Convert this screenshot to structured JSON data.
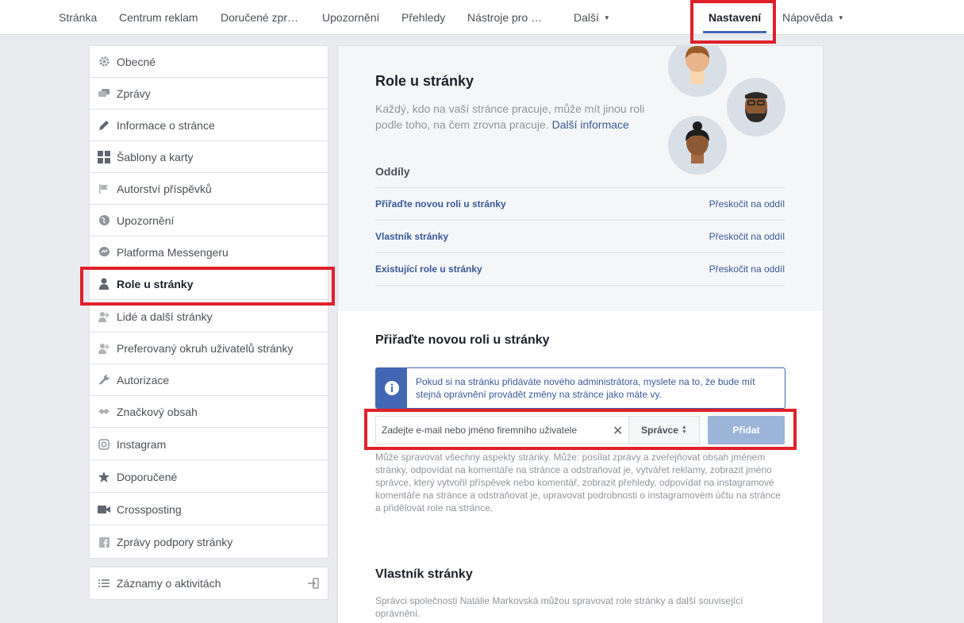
{
  "topnav": {
    "items": [
      "Stránka",
      "Centrum reklam",
      "Doručené zpr…",
      "Upozornění",
      "Přehledy",
      "Nástroje pro …",
      "Další",
      "Nastavení",
      "Nápověda"
    ],
    "active": "Nastavení"
  },
  "sidebar": {
    "items": [
      {
        "label": "Obecné",
        "icon": "gear-icon"
      },
      {
        "label": "Zprávy",
        "icon": "chat-icon"
      },
      {
        "label": "Informace o stránce",
        "icon": "pencil-icon"
      },
      {
        "label": "Šablony a karty",
        "icon": "grid-icon"
      },
      {
        "label": "Autorství příspěvků",
        "icon": "flag-icon"
      },
      {
        "label": "Upozornění",
        "icon": "globe-icon"
      },
      {
        "label": "Platforma Messengeru",
        "icon": "messenger-icon"
      },
      {
        "label": "Role u stránky",
        "icon": "person-icon"
      },
      {
        "label": "Lidé a další stránky",
        "icon": "people-icon"
      },
      {
        "label": "Preferovaný okruh uživatelů stránky",
        "icon": "people-icon"
      },
      {
        "label": "Autorizace",
        "icon": "wrench-icon"
      },
      {
        "label": "Značkový obsah",
        "icon": "handshake-icon"
      },
      {
        "label": "Instagram",
        "icon": "instagram-icon"
      },
      {
        "label": "Doporučené",
        "icon": "star-icon"
      },
      {
        "label": "Crossposting",
        "icon": "video-icon"
      },
      {
        "label": "Zprávy podpory stránky",
        "icon": "facebook-icon"
      }
    ],
    "active": "Role u stránky",
    "activity_log": "Záznamy o aktivitách"
  },
  "main": {
    "title": "Role u stránky",
    "intro": "Každý, kdo na vaší stránce pracuje, může mít jinou roli podle toho, na čem zrovna pracuje. ",
    "intro_link": "Další informace",
    "sections_title": "Oddíly",
    "sections": [
      {
        "label": "Přiřaďte novou roli u stránky",
        "jump": "Přeskočit na oddíl"
      },
      {
        "label": "Vlastník stránky",
        "jump": "Přeskočit na oddíl"
      },
      {
        "label": "Existující role u stránky",
        "jump": "Přeskočit na oddíl"
      }
    ],
    "assign_title": "Přiřaďte novou roli u stránky",
    "info_text": "Pokud si na stránku přidáváte nového administrátora, myslete na to, že bude mít stejná oprávnění provádět změny na stránce jako máte vy.",
    "email_placeholder": "Zadejte e-mail nebo jméno firemního uživatele",
    "role_value": "Správce",
    "add_label": "Přidat",
    "role_description": "Může spravovat všechny aspekty stránky. Může: posílat zprávy a zveřejňovat obsah jménem stránky, odpovídat na komentáře na stránce a odstraňovat je, vytvářet reklamy, zobrazit jméno správce, který vytvořil příspěvek nebo komentář, zobrazit přehledy, odpovídat na instagramové komentáře na stránce a odstraňovat je, upravovat podrobnosti o instagramovém účtu na stránce a přidělovat role na stránce.",
    "owner_title": "Vlastník stránky",
    "owner_text": "Správci společnosti Natálie Markovská můžou spravovat role stránky a další související oprávnění."
  },
  "colors": {
    "accent": "#4267b2",
    "link": "#385898",
    "highlight": "#e0202a"
  }
}
